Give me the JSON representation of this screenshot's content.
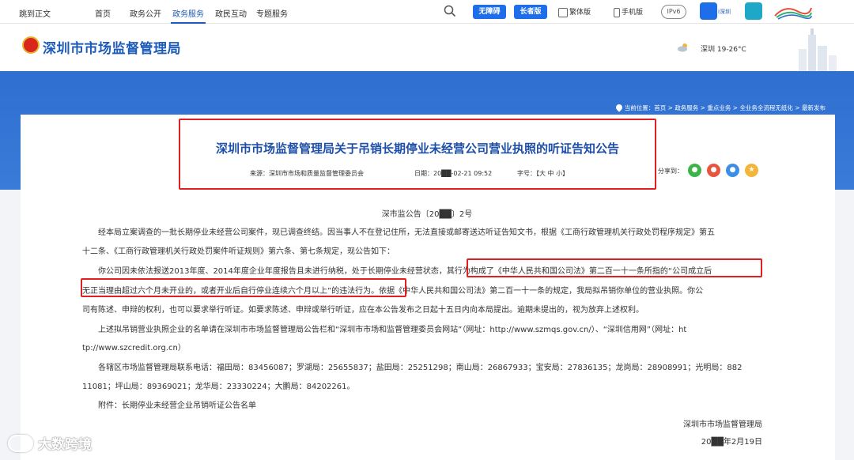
{
  "topbar": {
    "skip_label": "跳到正文",
    "nav": [
      "首页",
      "政务公开",
      "政务服务",
      "政民互动",
      "专题服务"
    ],
    "active_nav": "政务服务",
    "wuzhangai": "无障碍",
    "zhangzhe": "长者版",
    "fanti": "繁体版",
    "shouji": "手机版",
    "ipv6": "IPv6",
    "app1_label": "i深圳"
  },
  "header": {
    "site_title": "深圳市市场监督管理局",
    "weather": "深圳 19-26°C"
  },
  "breadcrumb": {
    "prefix": "当前位置：",
    "items": [
      "首页",
      "政务服务",
      "重点业务",
      "全业务全流程无纸化",
      "最新发布"
    ],
    "separator": " > "
  },
  "article": {
    "title": "深圳市市场监督管理局关于吊销长期停业未经营公司营业执照的听证告知公告",
    "source": "来源：深圳市市场和质量监督管理委员会",
    "date": "日期：20██-02-21 09:52",
    "font_size": "字号：【大 中 小】",
    "share_label": "分享到：",
    "doc_no": "深市监公告〔20██〕2号",
    "paragraphs": [
      "经本局立案调查的一批长期停业未经营公司案件，现已调查终结。因当事人不在登记住所，无法直接或邮寄送达听证告知文书，根据《工商行政管理机关行政处罚程序规定》第五",
      "十二条、《工商行政管理机关行政处罚案件听证规则》第六条、第七条规定，现公告如下：",
      "你公司因未依法报送2013年度、2014年度企业年度报告且未进行纳税，处于长期停业未经营状态，其行为构成了《中华人民共和国公司法》第二百一十一条所指的“公司成立后",
      "无正当理由超过六个月未开业的，或者开业后自行停业连续六个月以上”的违法行为。依据《中华人民共和国公司法》第二百一十一条的规定，我局拟吊销你单位的营业执照。你公",
      "司有陈述、申辩的权利，也可以要求举行听证。如要求陈述、申辩或举行听证，应在本公告发布之日起十五日内向本局提出。逾期未提出的，视为放弃上述权利。",
      "上述拟吊销营业执照企业的名单请在深圳市市场监督管理局公告栏和“深圳市市场和监督管理委员会网站”（网址：http://www.szmqs.gov.cn/）、“深圳信用网”（网址：ht",
      "tp://www.szcredit.org.cn）",
      "各辖区市场监督管理局联系电话：福田局：83456087；罗湖局：25655837；盐田局：25251298；南山局：26867933；宝安局：27836135；龙岗局：28908991；光明局：882",
      "11081；坪山局：89369021；龙华局：23330224；大鹏局：84202261。",
      "附件：长期停业未经营企业吊销听证公告名单"
    ],
    "signer": "深圳市市场监督管理局",
    "sign_date": "20██年2月19日"
  },
  "watermark": "大数跨境",
  "colors": {
    "brand_blue": "#1d5bb8",
    "band_blue": "#3a7ad8",
    "highlight_red": "#e02020"
  }
}
